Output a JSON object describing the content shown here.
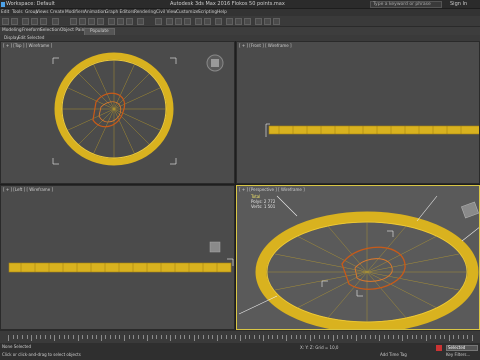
{
  "titlebar": {
    "workspace": "Workspace: Default",
    "app_title": "Autodesk 3ds Max 2016   Flokos 50 points.max",
    "search_placeholder": "Type a keyword or phrase",
    "sign_in": "Sign In"
  },
  "menu": [
    "Edit",
    "Tools",
    "Group",
    "Views",
    "Create",
    "Modifiers",
    "Animation",
    "Graph Editors",
    "Rendering",
    "Civil View",
    "Customize",
    "Scripting",
    "Help"
  ],
  "ribbon": {
    "tabs": [
      "Modeling",
      "Freeform",
      "Selection",
      "Object Paint",
      "Populate"
    ],
    "sub": [
      "Display",
      "Edit Selected"
    ]
  },
  "viewports": {
    "top_left_label": "[ + ] [Top ] [ Wireframe ]",
    "top_right_label": "[ + ] [Front ] [ Wireframe ]",
    "bottom_left_label": "[ + ] [Left ] [ Wireframe ]",
    "bottom_right_label": "[ + ] [Perspective ] [ Wireframe ]"
  },
  "stats": {
    "total_label": "Total",
    "polys_label": "Polys:",
    "polys_value": "2 772",
    "verts_label": "Verts:",
    "verts_value": "1 501"
  },
  "status": {
    "selection": "None Selected",
    "prompt": "Click or click-and-drag to select objects",
    "coords": "X:      Y:      Z:      Grid = 10,0",
    "selected": "Selected",
    "add_time_tag": "Add Time Tag",
    "set_key": "Key Filters..."
  },
  "colors": {
    "wire_yellow": "#d9b21f",
    "wire_orange": "#c85a18",
    "viewport_bg": "#4b4b4b",
    "active_border": "#d9c645"
  }
}
